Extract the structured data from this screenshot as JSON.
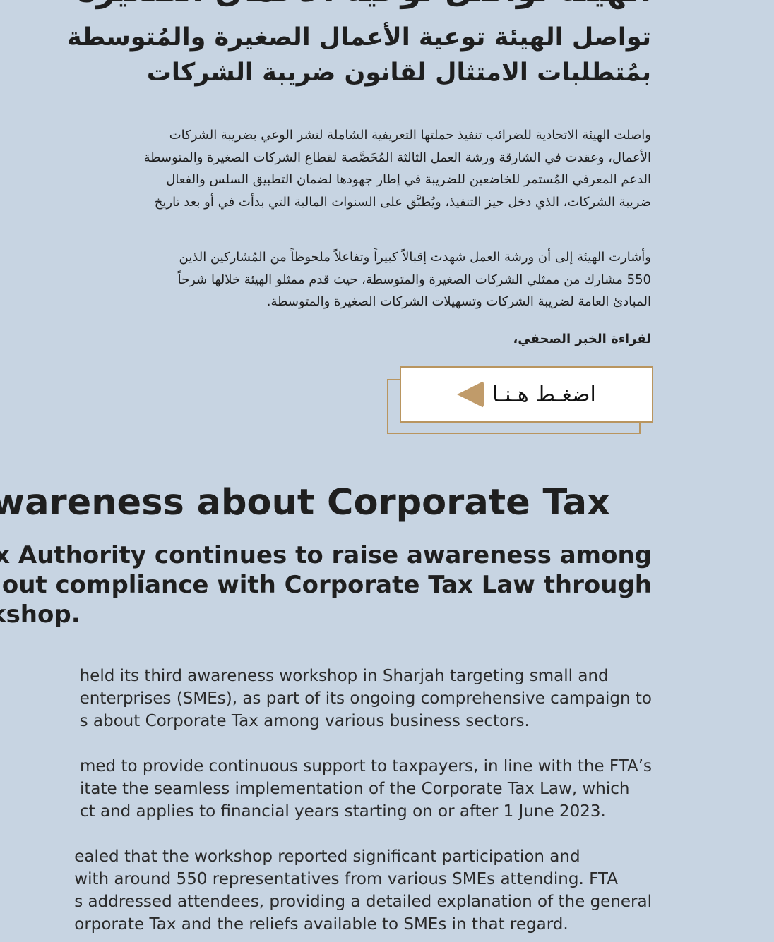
{
  "arabic": {
    "cut_title": "الهيئة تواصل توعية الأعمال الصغيرة",
    "subtitle_lines": [
      "تواصل الهيئة توعية الأعمال الصغيرة والمُتوسطة",
      "بمُتطلبات الامتثال لقانون ضريبة الشركات"
    ],
    "paragraph1_lines": [
      "واصلت الهيئة الاتحادية للضرائب تنفيذ حملتها التعريفية الشاملة لنشر الوعي بضريبة الشركات",
      "الأعمال، وعقدت في الشارقة ورشة العمل الثالثة المُخَصَّصة لقطاع الشركات الصغيرة والمتوسطة",
      "الدعم المعرفي المُستمر للخاضعين للضريبة في إطار جهودها لضمان التطبيق السلس والفعال",
      "ضريبة الشركات، الذي دخل حيز التنفيذ، ويُطبَّق على السنوات المالية التي بدأت في أو بعد تاريخ"
    ],
    "paragraph2_lines": [
      "وأشارت الهيئة إلى أن ورشة العمل شهدت إقبالاً كبيراً وتفاعلاً ملحوظاً من المُشاركين الذين",
      "550 مشارك من ممثلي الشركات الصغيرة والمتوسطة، حيث قدم ممثلو الهيئة خلالها شرحاً",
      "المبادئ العامة لضريبة الشركات وتسهيلات الشركات الصغيرة والمتوسطة."
    ],
    "read_more": "لقراءة الخبر الصحفي،",
    "button_label": "اضغـط هـنـا"
  },
  "english": {
    "title": "awareness about Corporate Tax",
    "subtitle_lines": [
      "ax Authority continues to raise awareness among",
      "out compliance with Corporate Tax Law through",
      "rkshop."
    ],
    "paragraph1_lines": [
      "held its third awareness workshop in Sharjah targeting small and",
      "enterprises (SMEs), as part of its ongoing comprehensive campaign to",
      "s about Corporate Tax among various business sectors."
    ],
    "paragraph2_lines": [
      "med to provide continuous support to taxpayers, in line with the FTA’s",
      "itate the seamless implementation of the Corporate Tax Law, which",
      "ct and applies to financial years starting on or after 1 June 2023."
    ],
    "paragraph3_lines": [
      "ealed that the workshop reported significant participation and",
      "with around 550 representatives from various SMEs attending. FTA",
      "s addressed attendees, providing a detailed explanation of the general",
      "orporate Tax and the reliefs available to SMEs in that regard."
    ]
  },
  "colors": {
    "background": "#c7d4e2",
    "accent_gold": "#b9955f",
    "arrow": "#c09b6a",
    "text": "#1f1f1f"
  }
}
